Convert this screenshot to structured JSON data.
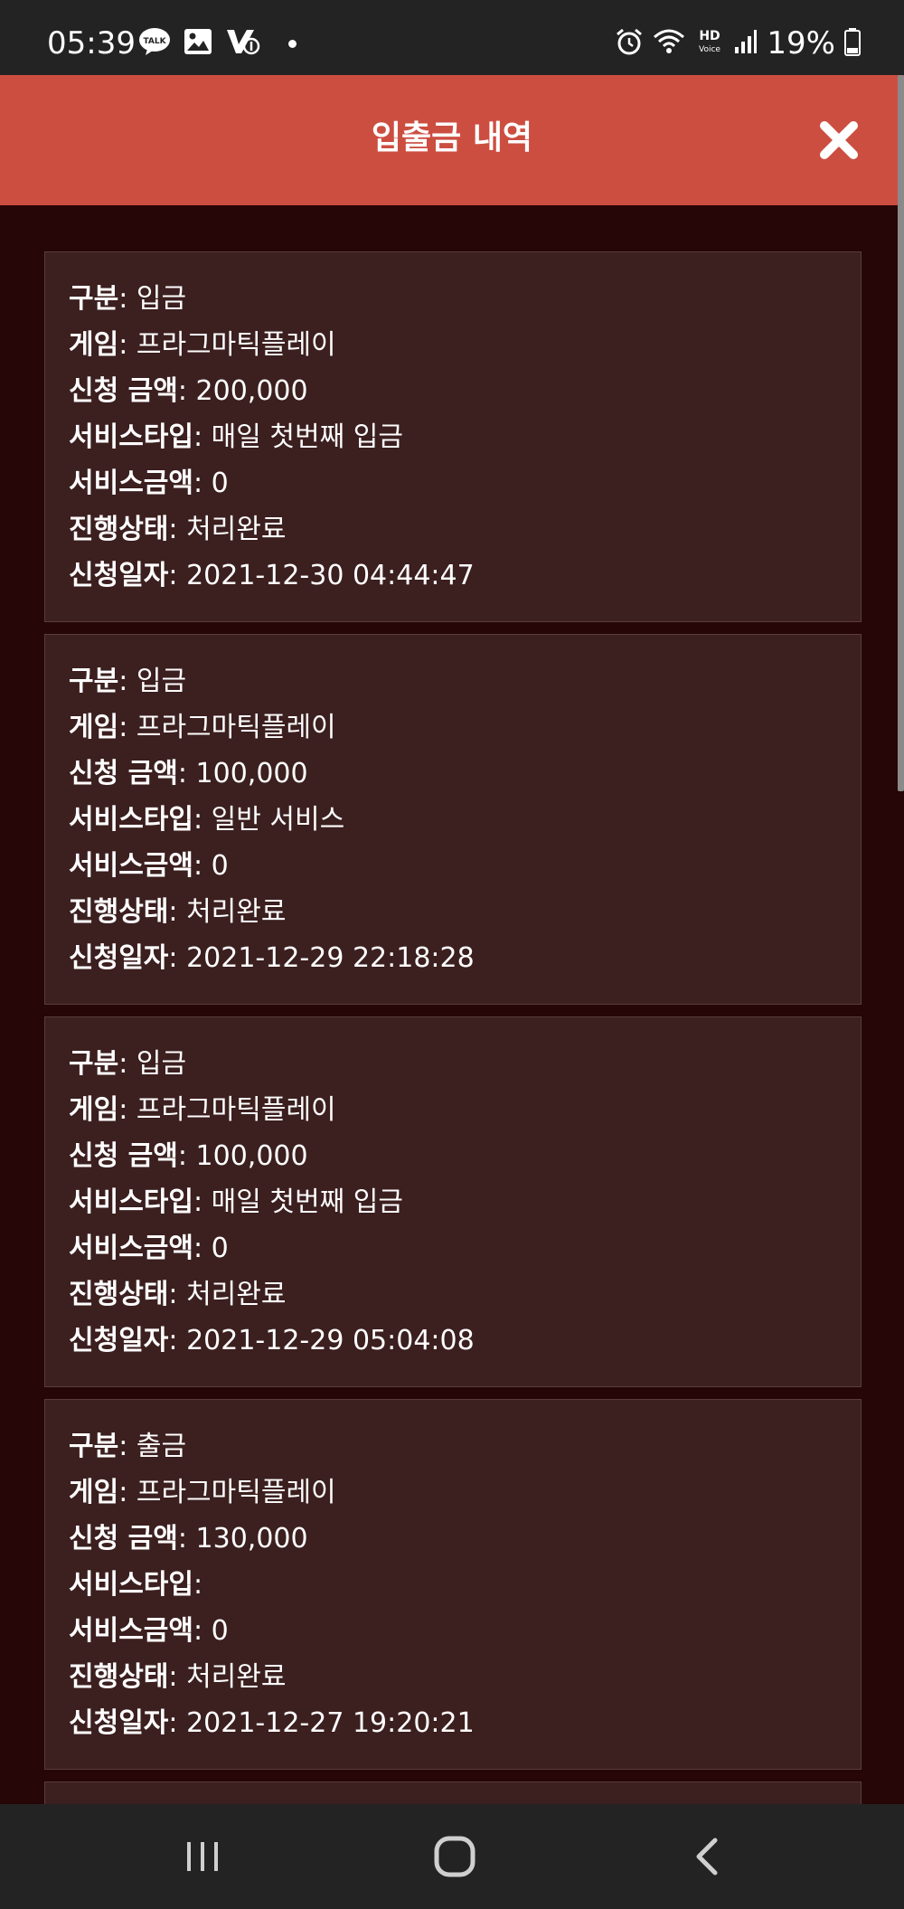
{
  "status_bar": {
    "time": "05:39",
    "battery": "19%",
    "icons_left": [
      "talk-icon",
      "gallery-icon",
      "v-icon"
    ],
    "icons_right": [
      "alarm-icon",
      "wifi-icon",
      "hd-voice-icon",
      "signal-icon",
      "battery-icon"
    ],
    "hd_label": "HD",
    "voice_label": "Voice",
    "talk_label": "TALK"
  },
  "header": {
    "title": "입출금 내역",
    "background": "#cc4e41"
  },
  "labels": {
    "type": "구분",
    "game": "게임",
    "amount": "신청 금액",
    "service_type": "서비스타입",
    "service_amount": "서비스금액",
    "status": "진행상태",
    "date": "신청일자"
  },
  "records": [
    {
      "type": "입금",
      "game": "프라그마틱플레이",
      "amount": "200,000",
      "service_type": "매일 첫번째 입금",
      "service_amount": "0",
      "status": "처리완료",
      "date": "2021-12-30 04:44:47"
    },
    {
      "type": "입금",
      "game": "프라그마틱플레이",
      "amount": "100,000",
      "service_type": "일반 서비스",
      "service_amount": "0",
      "status": "처리완료",
      "date": "2021-12-29 22:18:28"
    },
    {
      "type": "입금",
      "game": "프라그마틱플레이",
      "amount": "100,000",
      "service_type": "매일 첫번째 입금",
      "service_amount": "0",
      "status": "처리완료",
      "date": "2021-12-29 05:04:08"
    },
    {
      "type": "출금",
      "game": "프라그마틱플레이",
      "amount": "130,000",
      "service_type": "",
      "service_amount": "0",
      "status": "처리완료",
      "date": "2021-12-27 19:20:21"
    }
  ],
  "colors": {
    "page_background": "#260606",
    "card_background": "#3c1f1f",
    "card_border": "#5a3c3c",
    "bars": "#232323"
  },
  "nav": [
    "recent-apps-icon",
    "home-icon",
    "back-icon"
  ]
}
